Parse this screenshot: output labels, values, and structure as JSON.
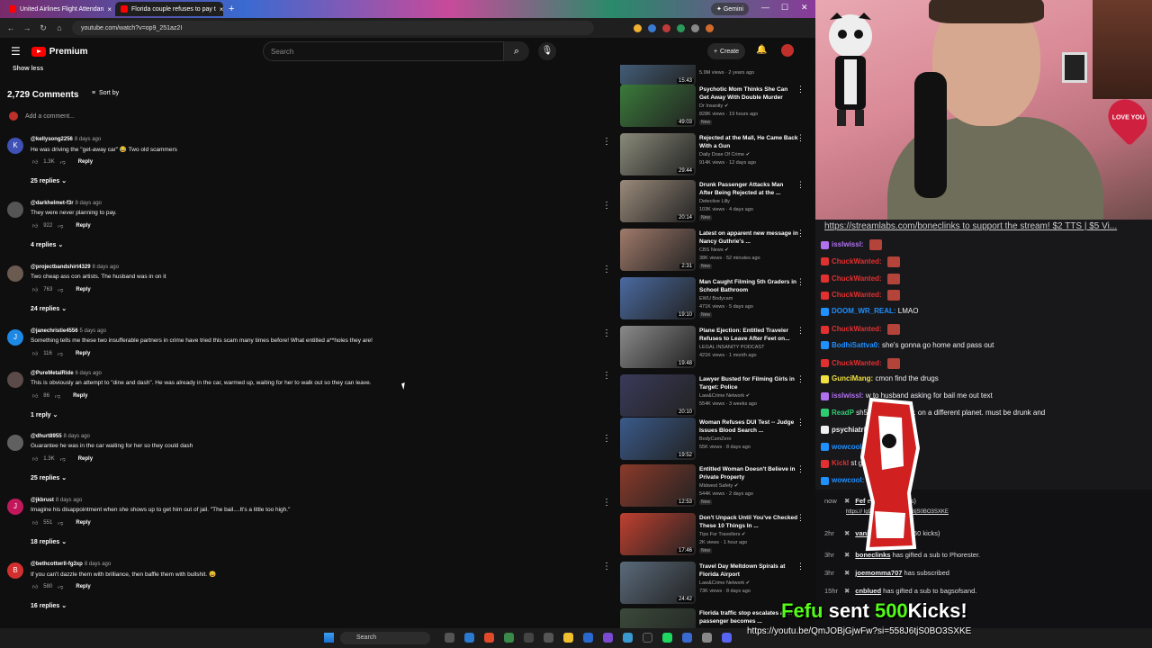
{
  "browser": {
    "tabs": [
      {
        "label": "United Airlines Flight Attendan"
      },
      {
        "label": "Florida couple refuses to pay t"
      }
    ],
    "gemini_label": "Gemini",
    "url": "youtube.com/watch?v=op9_251az2I"
  },
  "youtube": {
    "brand": "Premium",
    "search_placeholder": "Search",
    "create_label": "Create",
    "show_less": "Show less",
    "comment_count": "2,729 Comments",
    "sort_label": "Sort by",
    "add_comment": "Add a comment...",
    "comments": [
      {
        "avatar": "K",
        "avatar_color": "#3f51b5",
        "handle": "@kellysong2256",
        "ago": "8 days ago",
        "text": "He was driving the \"get-away car\" 😂 Two old scammers",
        "likes": "1.3K",
        "reply": "Reply",
        "replies": "25 replies"
      },
      {
        "avatar": "",
        "avatar_color": "#555555",
        "handle": "@darkhelmet-f3r",
        "ago": "8 days ago",
        "text": "They were never planning to pay.",
        "likes": "922",
        "reply": "Reply",
        "replies": "4 replies"
      },
      {
        "avatar": "",
        "avatar_color": "#6a5a50",
        "handle": "@projectbandshirt4329",
        "ago": "8 days ago",
        "text": "Two cheap ass con artists.  The husband was in on it",
        "likes": "763",
        "reply": "Reply",
        "replies": "24 replies"
      },
      {
        "avatar": "J",
        "avatar_color": "#1e88e5",
        "handle": "@janechristie4556",
        "ago": "5 days ago",
        "text": "Something tells me these two insufferable partners in crime have tried this scam many times before! What entitled a**holes they are!",
        "likes": "116",
        "reply": "Reply",
        "replies": ""
      },
      {
        "avatar": "",
        "avatar_color": "#5a4a4a",
        "handle": "@PureMetalRide",
        "ago": "6 days ago",
        "text": "This is obviously an attempt to \"dine and dash\". He was already in the car, warmed up, waiting for her to walk out so they can leave.",
        "likes": "86",
        "reply": "Reply",
        "replies": "1 reply"
      },
      {
        "avatar": "",
        "avatar_color": "#606060",
        "handle": "@dhurt8955",
        "ago": "8 days ago",
        "text": "Guarantee he was in the car waiting for her so they could dash",
        "likes": "1.3K",
        "reply": "Reply",
        "replies": "25 replies"
      },
      {
        "avatar": "J",
        "avatar_color": "#c2185b",
        "handle": "@jkbrust",
        "ago": "8 days ago",
        "text": "Imagine his disappointment when she shows up to get him out of jail. \"The bail....It's a little too high.\"",
        "likes": "551",
        "reply": "Reply",
        "replies": "18 replies"
      },
      {
        "avatar": "B",
        "avatar_color": "#d32f2f",
        "handle": "@bethcottwrll-fg3xp",
        "ago": "8 days ago",
        "text": "If you can't dazzle them with brilliance, then baffle them with bullshit. 😄",
        "likes": "580",
        "reply": "Reply",
        "replies": "16 replies"
      }
    ],
    "related": [
      {
        "title": "",
        "channel": "",
        "views": "5.9M views · 2 years ago",
        "duration": "15:43",
        "badge": "",
        "thumb": "#4a6a8a"
      },
      {
        "title": "Psychotic Mom Thinks She Can Get Away With Double Murder",
        "channel": "Dr Insanity ✔",
        "views": "828K views · 19 hours ago",
        "duration": "49:03",
        "badge": "New",
        "thumb": "#3a7a3a"
      },
      {
        "title": "Rejected at the Mall, He Came Back With a Gun",
        "channel": "Daily Dose Of Crime ✔",
        "views": "914K views · 12 days ago",
        "duration": "29:44",
        "badge": "",
        "thumb": "#8a8a7a"
      },
      {
        "title": "Drunk Passenger Attacks Man After Being Rejected at the ...",
        "channel": "Detective Lilly",
        "views": "103K views · 4 days ago",
        "duration": "20:14",
        "badge": "New",
        "thumb": "#9a8a7a"
      },
      {
        "title": "Latest on apparent new message in Nancy Guthrie's ...",
        "channel": "CBS News ✔",
        "views": "38K views · 52 minutes ago",
        "duration": "2:31",
        "badge": "New",
        "thumb": "#a07a6a"
      },
      {
        "title": "Man Caught Filming 5th Graders in School Bathroom",
        "channel": "EWU Bodycam",
        "views": "471K views · 5 days ago",
        "duration": "19:10",
        "badge": "New",
        "thumb": "#4a6aa0"
      },
      {
        "title": "Plane Ejection: Entitled Traveler Refuses to Leave After Feet on...",
        "channel": "LEGAL INSANITY PODCAST",
        "views": "421K views · 1 month ago",
        "duration": "19:48",
        "badge": "",
        "thumb": "#8a8a8a"
      },
      {
        "title": "Lawyer Busted for Filming Girls in Target: Police",
        "channel": "Law&Crime Network ✔",
        "views": "554K views · 3 weeks ago",
        "duration": "20:10",
        "badge": "",
        "thumb": "#3a3a5a"
      },
      {
        "title": "Woman Refuses DUI Test -- Judge Issues Blood Search ...",
        "channel": "BodyCamZero",
        "views": "55K views · 8 days ago",
        "duration": "19:52",
        "badge": "",
        "thumb": "#3a5a8a"
      },
      {
        "title": "Entitled Woman Doesn't Believe in Private Property",
        "channel": "Midwest Safety ✔",
        "views": "544K views · 2 days ago",
        "duration": "12:53",
        "badge": "New",
        "thumb": "#8a3a2a"
      },
      {
        "title": "Don't Unpack Until You've Checked These 10 Things In ...",
        "channel": "Tips For Travellers ✔",
        "views": "2K views · 1 hour ago",
        "duration": "17:46",
        "badge": "New",
        "thumb": "#c04030"
      },
      {
        "title": "Travel Day Meltdown Spirals at Florida Airport",
        "channel": "Law&Crime Network ✔",
        "views": "73K views · 8 days ago",
        "duration": "24:42",
        "badge": "",
        "thumb": "#5a6a7a"
      },
      {
        "title": "Florida traffic stop escalates after passenger becomes ...",
        "channel": "",
        "views": "",
        "duration": "",
        "badge": "",
        "thumb": "#3a4a3a"
      }
    ]
  },
  "stream": {
    "banner": "https://streamlabs.com/boneclinks to support the stream! $2 TTS | $5 Vi...",
    "heart_text": "LOVE YOU",
    "chat": [
      {
        "user": "isslwissl:",
        "user_color": "#b070f0",
        "msg": "",
        "emote": true
      },
      {
        "user": "ChuckWanted:",
        "user_color": "#e03030",
        "msg": "",
        "emote": true
      },
      {
        "user": "ChuckWanted:",
        "user_color": "#e03030",
        "msg": "",
        "emote": true
      },
      {
        "user": "ChuckWanted:",
        "user_color": "#e03030",
        "msg": "",
        "emote": true
      },
      {
        "user": "DOOM_WR_REAL:",
        "user_color": "#1e90ff",
        "msg": "LMAO",
        "emote": false
      },
      {
        "user": "ChuckWanted:",
        "user_color": "#e03030",
        "msg": "",
        "emote": true
      },
      {
        "user": "BodhiSattva0:",
        "user_color": "#1e90ff",
        "msg": "she's gonna go home and pass out",
        "emote": false
      },
      {
        "user": "ChuckWanted:",
        "user_color": "#e03030",
        "msg": "",
        "emote": true
      },
      {
        "user": "GunciMang:",
        "user_color": "#f0e040",
        "msg": "cmon find the drugs",
        "emote": false
      },
      {
        "user": "isslwissl:",
        "user_color": "#b070f0",
        "msg": "w          to husband asking for bail me out text",
        "emote": false
      },
      {
        "user": "ReadP",
        "user_color": "#2ecc71",
        "msg": "          sh53_5: she loony. on a different planet. must be drunk and",
        "emote": false
      },
      {
        "user": "psychiatric",
        "user_color": "#efeff1",
        "msg": "",
        "emote": false
      },
      {
        "user": "wowcool:",
        "user_color": "#1e90ff",
        "msg": "          bag lmao",
        "emote": false
      },
      {
        "user": "Kickl",
        "user_color": "#e03030",
        "msg": "          st gifted 500 KICKs!",
        "emote": false
      },
      {
        "user": "wowcool:",
        "user_color": "#1e90ff",
        "msg": "",
        "emote": false
      }
    ],
    "events": [
      {
        "time": "now",
        "name": "Fef",
        "text": "e Quit (50 kicks)",
        "link": "https://        Ig9iJgwFw?si=558J6tjS0BO3SXKE"
      },
      {
        "time": "2hr",
        "name": "vani",
        "text": "it Skull Emoji (50 kicks)",
        "link": ""
      },
      {
        "time": "3hr",
        "name": "boneclinks",
        "text": "has gifted a sub to Phorester.",
        "link": ""
      },
      {
        "time": "3hr",
        "name": "joemomma707",
        "text": "has subscribed",
        "link": ""
      },
      {
        "time": "15hr",
        "name": "cnblued",
        "text": "has gifted a sub to bagsofsand.",
        "link": ""
      }
    ],
    "alert_name": "Fefu",
    "alert_mid": "sent",
    "alert_amount": "500",
    "alert_end": "Kicks!",
    "link_overlay": "https://youtu.be/QmJOBjGjwFw?si=558J6tjS0BO3SXKE"
  },
  "taskbar": {
    "search_label": "Search"
  }
}
